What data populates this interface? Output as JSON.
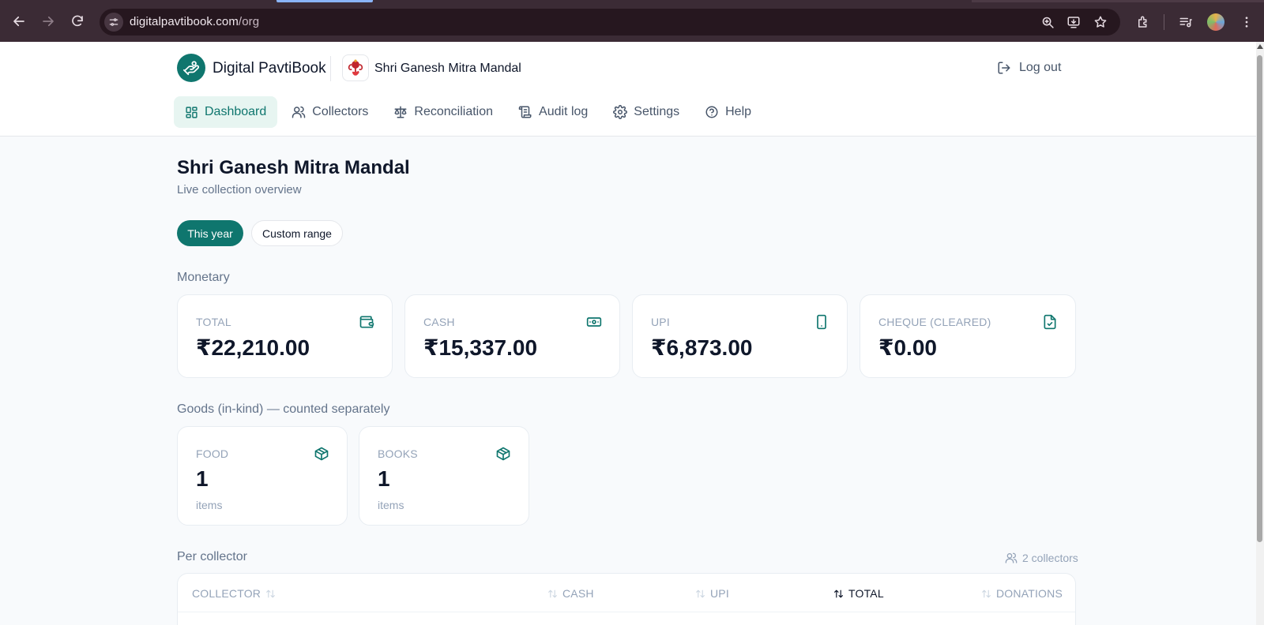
{
  "browser": {
    "url_host": "digitalpavtibook.com",
    "url_path": "/org",
    "toolbar_icons": [
      "back-icon",
      "forward-icon",
      "reload-icon",
      "site-info-icon",
      "zoom-icon",
      "install-app-icon",
      "bookmark-star-icon",
      "extensions-icon",
      "media-controls-icon",
      "profile-avatar",
      "menu-icon"
    ]
  },
  "header": {
    "brand": "Digital PavtiBook",
    "org_name": "Shri Ganesh Mitra Mandal",
    "logout_label": "Log out"
  },
  "nav": {
    "dashboard": "Dashboard",
    "collectors": "Collectors",
    "reconciliation": "Reconciliation",
    "audit_log": "Audit log",
    "settings": "Settings",
    "help": "Help"
  },
  "page": {
    "title": "Shri Ganesh Mitra Mandal",
    "subtitle": "Live collection overview"
  },
  "filters": {
    "this_year": "This year",
    "custom_range": "Custom range"
  },
  "monetary": {
    "label": "Monetary",
    "cards": [
      {
        "label": "TOTAL",
        "value": "₹22,210.00",
        "icon": "wallet-icon"
      },
      {
        "label": "CASH",
        "value": "₹15,337.00",
        "icon": "banknote-icon"
      },
      {
        "label": "UPI",
        "value": "₹6,873.00",
        "icon": "smartphone-icon"
      },
      {
        "label": "CHEQUE (CLEARED)",
        "value": "₹0.00",
        "icon": "file-check-icon"
      }
    ]
  },
  "goods": {
    "label": "Goods (in-kind) — counted separately",
    "cards": [
      {
        "label": "FOOD",
        "value": "1",
        "unit": "items",
        "icon": "package-icon"
      },
      {
        "label": "BOOKS",
        "value": "1",
        "unit": "items",
        "icon": "package-icon"
      }
    ]
  },
  "per_collector": {
    "label": "Per collector",
    "count": "2 collectors",
    "columns": {
      "collector": "COLLECTOR",
      "cash": "CASH",
      "upi": "UPI",
      "total": "TOTAL",
      "donations": "DONATIONS"
    }
  },
  "colors": {
    "brand": "#0f766e",
    "active_nav_bg": "#e7f5f1",
    "chrome_bg": "#3b2b35"
  }
}
